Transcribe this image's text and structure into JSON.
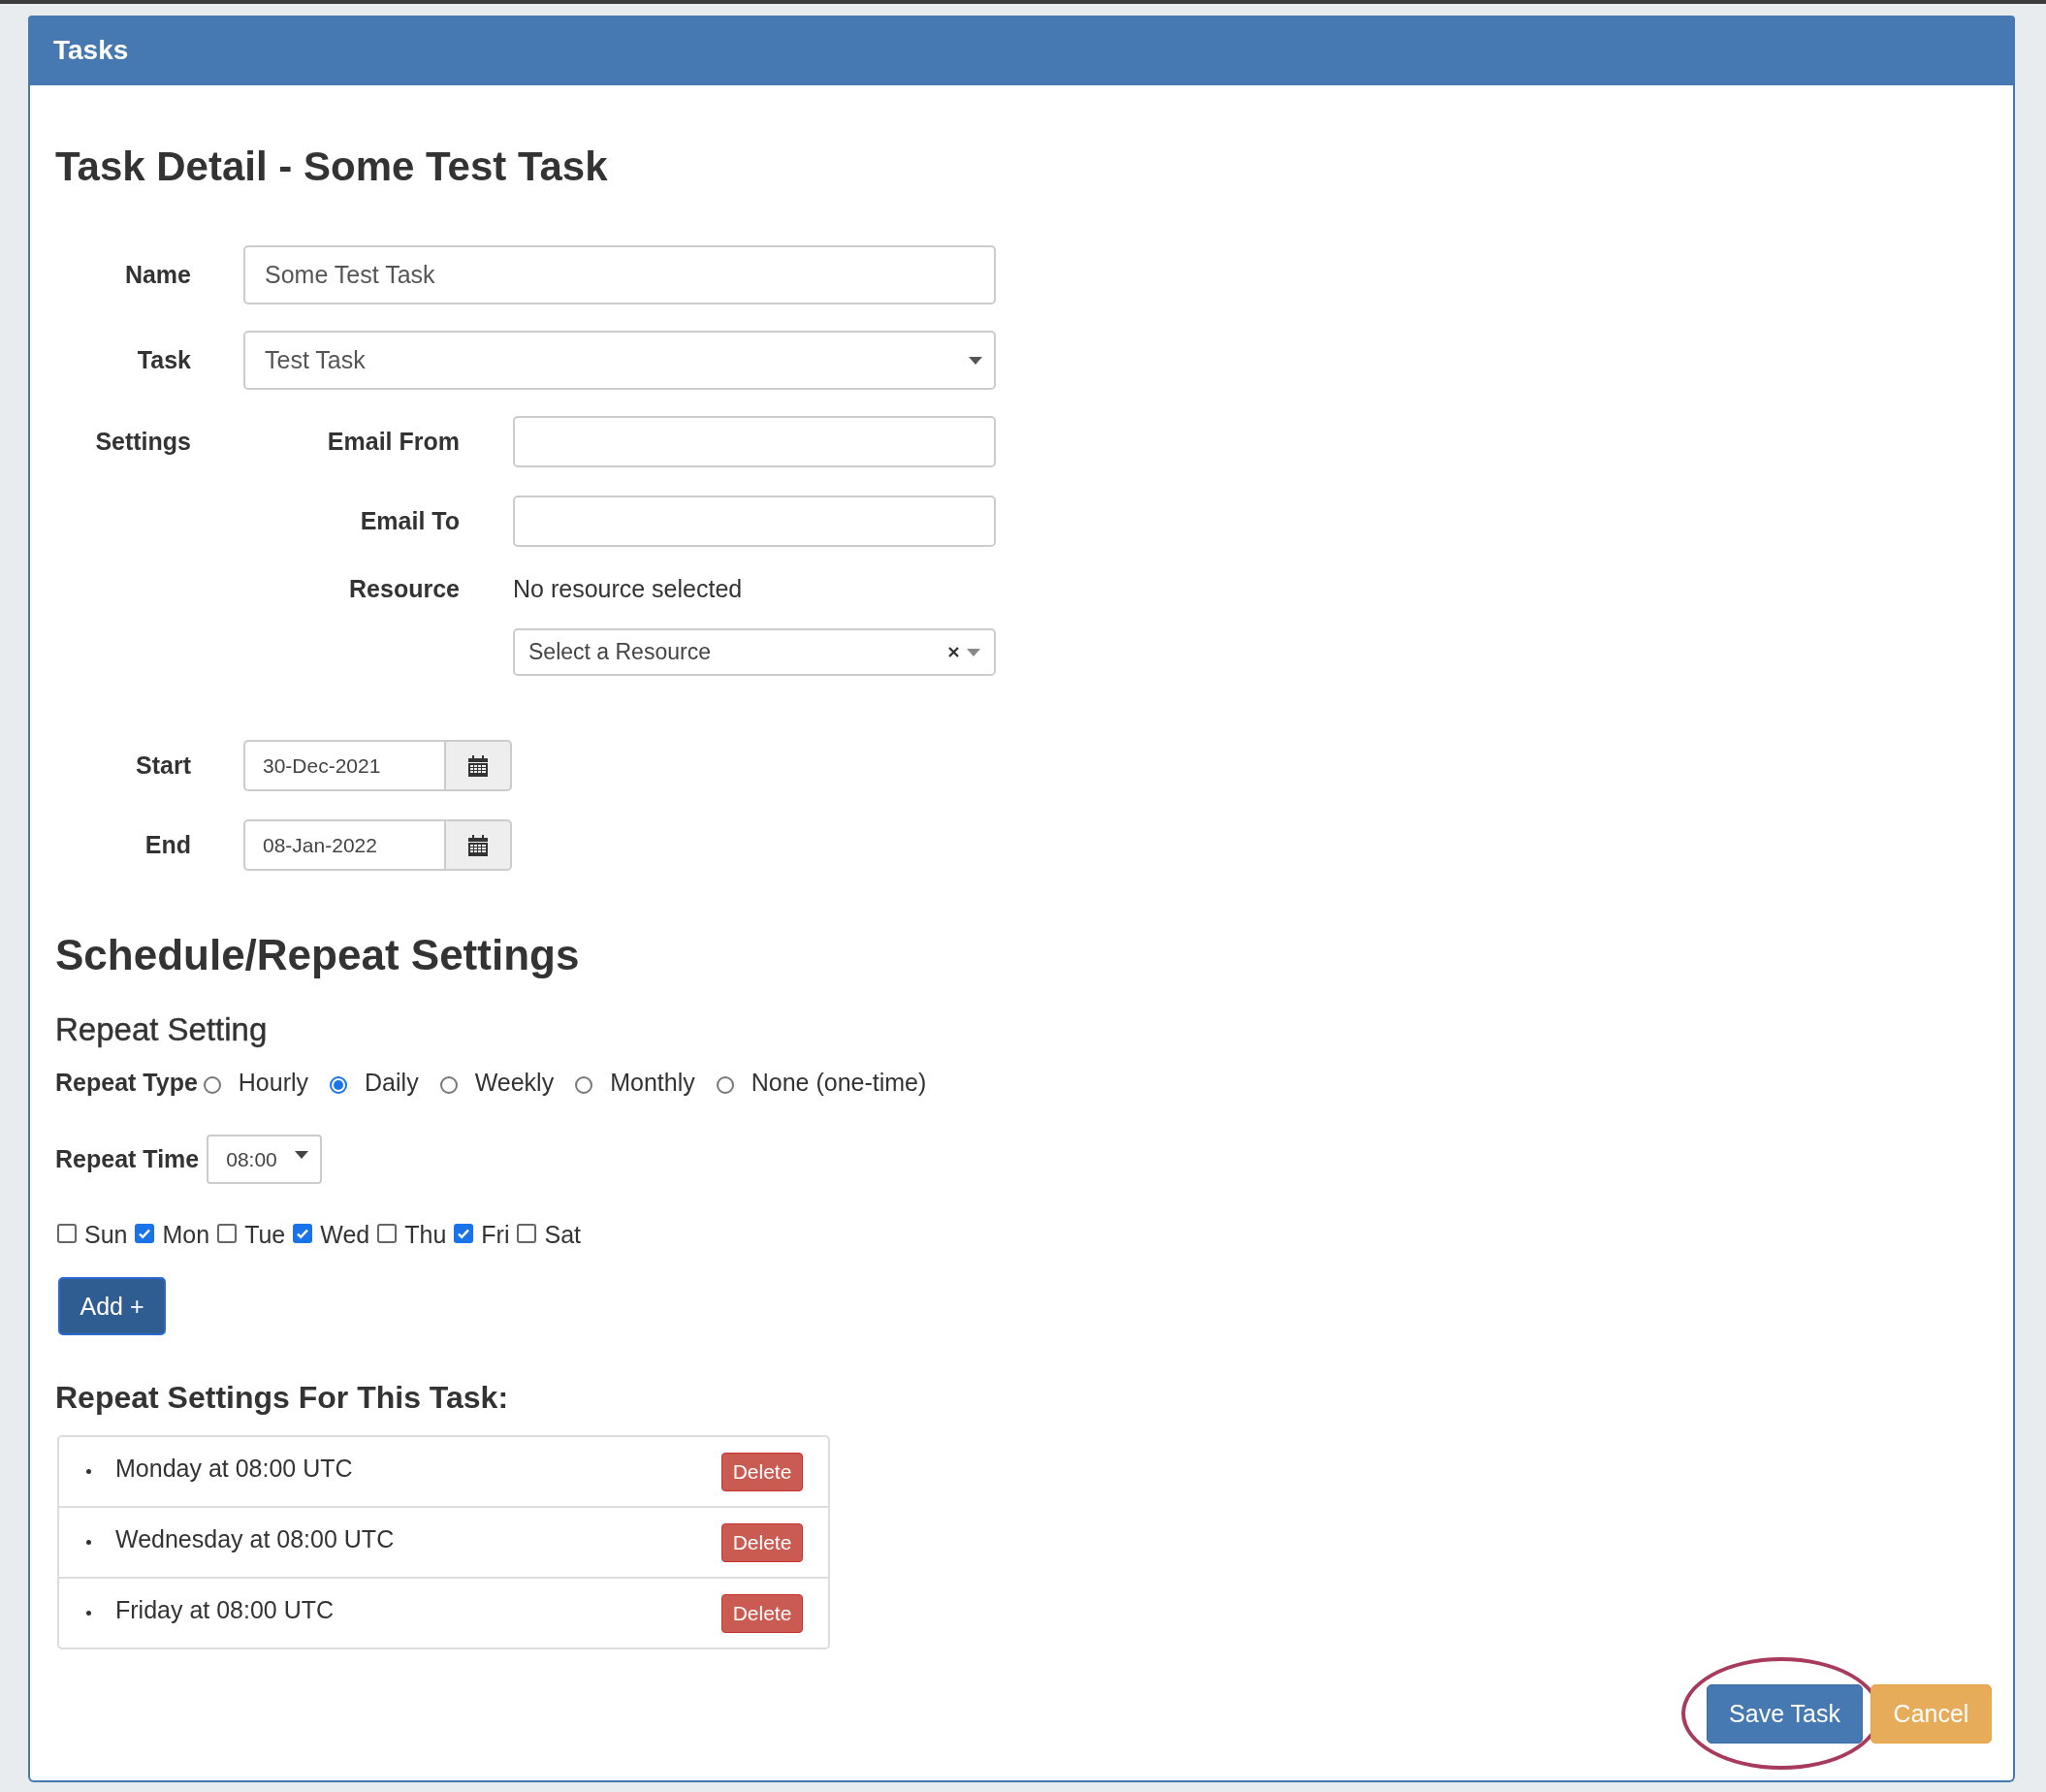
{
  "panel": {
    "title": "Tasks"
  },
  "heading": "Task Detail - Some Test Task",
  "fields": [
    {
      "kind": "text",
      "label": "Name",
      "value": "Some Test Task"
    },
    {
      "kind": "select",
      "label": "Task",
      "value": "Test Task"
    }
  ],
  "settings": {
    "label": "Settings",
    "fields": [
      {
        "kind": "text",
        "label": "Email From"
      },
      {
        "kind": "text",
        "label": "Email To"
      },
      {
        "kind": "resource",
        "label": "Resource",
        "status": "No resource selected",
        "placeholder": "Select a Resource"
      }
    ]
  },
  "dates": [
    {
      "label": "Start",
      "value": "30-Dec-2021"
    },
    {
      "label": "End",
      "value": "08-Jan-2022"
    }
  ],
  "schedule": {
    "heading": "Schedule/Repeat Settings",
    "subheading": "Repeat Setting",
    "repeat_type": {
      "label": "Repeat Type",
      "options": [
        {
          "label": "Hourly",
          "selected": false
        },
        {
          "label": "Daily",
          "selected": true
        },
        {
          "label": "Weekly",
          "selected": false
        },
        {
          "label": "Monthly",
          "selected": false
        },
        {
          "label": "None (one-time)",
          "selected": false
        }
      ]
    },
    "repeat_time": {
      "label": "Repeat Time",
      "value": "08:00"
    },
    "days": [
      {
        "label": "Sun",
        "checked": false
      },
      {
        "label": "Mon",
        "checked": true
      },
      {
        "label": "Tue",
        "checked": false
      },
      {
        "label": "Wed",
        "checked": true
      },
      {
        "label": "Thu",
        "checked": false
      },
      {
        "label": "Fri",
        "checked": true
      },
      {
        "label": "Sat",
        "checked": false
      }
    ],
    "add_button": "Add +"
  },
  "repeat_list": {
    "heading": "Repeat Settings For This Task:",
    "items": [
      {
        "text": "Monday at 08:00 UTC",
        "action": "Delete"
      },
      {
        "text": "Wednesday at 08:00 UTC",
        "action": "Delete"
      },
      {
        "text": "Friday at 08:00 UTC",
        "action": "Delete"
      }
    ]
  },
  "buttons": [
    {
      "label": "Save Task",
      "kind": "primary",
      "highlighted": true
    },
    {
      "label": "Cancel",
      "kind": "warning",
      "highlighted": false
    }
  ]
}
